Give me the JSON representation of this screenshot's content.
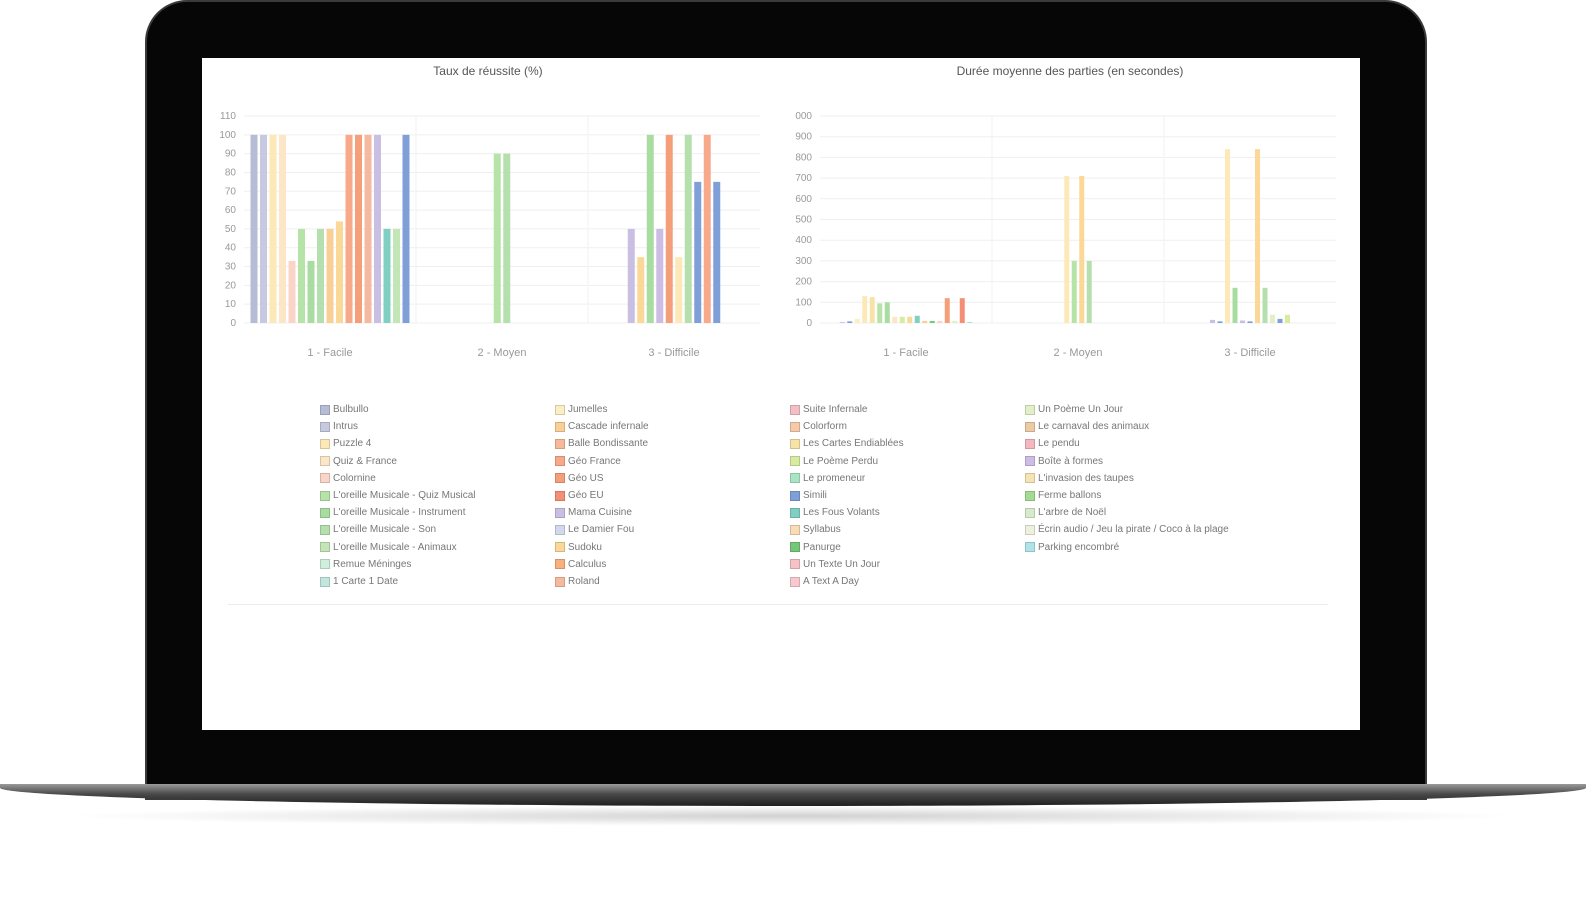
{
  "colors": {
    "Bulbullo": "#b7bcd6",
    "Intrus": "#c6c9e0",
    "Puzzle 4": "#fde9b8",
    "Quiz & France": "#fde6c8",
    "Colornine": "#f9d4c7",
    "L'oreille Musicale - Quiz Musical": "#b6e3a8",
    "L'oreille Musicale - Instrument": "#a9dca0",
    "L'oreille Musicale - Son": "#b5e0ae",
    "L'oreille Musicale - Animaux": "#c2e6b5",
    "Remue Méninges": "#cfeedd",
    "1 Carte 1 Date": "#bfe7de",
    "Jumelles": "#fbeec3",
    "Cascade infernale": "#f9cf96",
    "Balle Bondissante": "#f8b99a",
    "Géo France": "#f7a98a",
    "Géo US": "#f59e7a",
    "Géo EU": "#f28f74",
    "Mama Cuisine": "#c9bfe3",
    "Le Damier Fou": "#d3d8ee",
    "Sudoku": "#fbd897",
    "Calculus": "#f7b07e",
    "Roland": "#f5b9a0",
    "Suite Infernale": "#f3bfc4",
    "Colorform": "#f6c9aa",
    "Les Cartes Endiablées": "#f8e3a6",
    "Le Poème Perdu": "#d8eca0",
    "Le promeneur": "#a9e4c4",
    "Simili": "#7f9fd8",
    "Les Fous Volants": "#7fd0c2",
    "Syllabus": "#f8dcb4",
    "Panurge": "#74c779",
    "Un Texte Un Jour": "#f6c2c6",
    "A Text A Day": "#f7c8cf",
    "Un Poème Un Jour": "#e3efc6",
    "Le carnaval des animaux": "#eccaa3",
    "Le pendu": "#f4b7bf",
    "Boîte à formes": "#cdbde6",
    "L'invasion des taupes": "#f5e4b3",
    "Ferme ballons": "#a3db93",
    "L'arbre de Noël": "#d7ebca",
    "Écrin audio / Jeu la pirate / Coco à la plage": "#eef0de",
    "Parking encombré": "#aee3e8"
  },
  "legend_columns": [
    [
      "Bulbullo",
      "Intrus",
      "Puzzle 4",
      "Quiz & France",
      "Colornine",
      "L'oreille Musicale - Quiz Musical",
      "L'oreille Musicale - Instrument",
      "L'oreille Musicale - Son",
      "L'oreille Musicale - Animaux",
      "Remue Méninges",
      "1 Carte 1 Date"
    ],
    [
      "Jumelles",
      "Cascade infernale",
      "Balle Bondissante",
      "Géo France",
      "Géo US",
      "Géo EU",
      "Mama Cuisine",
      "Le Damier Fou",
      "Sudoku",
      "Calculus",
      "Roland"
    ],
    [
      "Suite Infernale",
      "Colorform",
      "Les Cartes Endiablées",
      "Le Poème Perdu",
      "Le promeneur",
      "Simili",
      "Les Fous Volants",
      "Syllabus",
      "Panurge",
      "Un Texte Un Jour",
      "A Text A Day"
    ],
    [
      "Un Poème Un Jour",
      "Le carnaval des animaux",
      "Le pendu",
      "Boîte à formes",
      "L'invasion des taupes",
      "Ferme ballons",
      "L'arbre de Noël",
      "Écrin audio / Jeu la pirate / Coco à la plage",
      "Parking encombré"
    ]
  ],
  "chart_data": [
    {
      "type": "bar",
      "title": "Taux de réussite (%)",
      "categories": [
        "1 - Facile",
        "2 - Moyen",
        "3 - Difficile"
      ],
      "ylim": [
        0,
        110
      ],
      "yticks": [
        0,
        10,
        20,
        30,
        40,
        50,
        60,
        70,
        80,
        90,
        100,
        110
      ],
      "grid": true,
      "groups": [
        [
          [
            "Bulbullo",
            100
          ],
          [
            "Intrus",
            100
          ],
          [
            "Puzzle 4",
            100
          ],
          [
            "Quiz & France",
            100
          ],
          [
            "Colornine",
            33
          ],
          [
            "L'oreille Musicale - Quiz Musical",
            50
          ],
          [
            "L'oreille Musicale - Instrument",
            33
          ],
          [
            "L'oreille Musicale - Son",
            50
          ],
          [
            "Cascade infernale",
            50
          ],
          [
            "Sudoku",
            54
          ],
          [
            "Géo France",
            100
          ],
          [
            "Géo US",
            100
          ],
          [
            "Roland",
            100
          ],
          [
            "Mama Cuisine",
            100
          ],
          [
            "Les Fous Volants",
            50
          ],
          [
            "L'oreille Musicale - Animaux",
            50
          ],
          [
            "Simili",
            100
          ]
        ],
        [
          [
            "L'oreille Musicale - Quiz Musical",
            90
          ],
          [
            "L'oreille Musicale - Son",
            90
          ]
        ],
        [
          [
            "Mama Cuisine",
            50
          ],
          [
            "Sudoku",
            35
          ],
          [
            "L'oreille Musicale - Instrument",
            100
          ],
          [
            "Boîte à formes",
            50
          ],
          [
            "Géo US",
            100
          ],
          [
            "Puzzle 4",
            35
          ],
          [
            "L'oreille Musicale - Son",
            100
          ],
          [
            "Simili",
            75
          ],
          [
            "Géo France",
            100
          ],
          [
            "Simili",
            75
          ]
        ]
      ]
    },
    {
      "type": "bar",
      "title": "Durée moyenne des parties (en secondes)",
      "categories": [
        "1 - Facile",
        "2 - Moyen",
        "3 - Difficile"
      ],
      "ylim": [
        0,
        1000
      ],
      "yticks": [
        0,
        100,
        200,
        300,
        400,
        500,
        600,
        700,
        800,
        900,
        1000
      ],
      "ytick_labels": [
        "0",
        "100",
        "200",
        "300",
        "400",
        "500",
        "600",
        "700",
        "800",
        "900",
        "000"
      ],
      "grid": true,
      "groups": [
        [
          [
            "Intrus",
            5
          ],
          [
            "Simili",
            8
          ],
          [
            "Jumelles",
            20
          ],
          [
            "Puzzle 4",
            130
          ],
          [
            "Les Cartes Endiablées",
            125
          ],
          [
            "L'oreille Musicale - Quiz Musical",
            95
          ],
          [
            "L'oreille Musicale - Instrument",
            100
          ],
          [
            "Quiz & France",
            30
          ],
          [
            "Le Poème Perdu",
            30
          ],
          [
            "Sudoku",
            30
          ],
          [
            "Les Fous Volants",
            35
          ],
          [
            "Cascade infernale",
            10
          ],
          [
            "Panurge",
            10
          ],
          [
            "Colornine",
            10
          ],
          [
            "Géo US",
            120
          ],
          [
            "Un Poème Un Jour",
            10
          ],
          [
            "Géo EU",
            120
          ],
          [
            "Le promeneur",
            5
          ]
        ],
        [
          [
            "Puzzle 4",
            710
          ],
          [
            "L'oreille Musicale - Quiz Musical",
            300
          ],
          [
            "Sudoku",
            710
          ],
          [
            "L'oreille Musicale - Son",
            300
          ]
        ],
        [
          [
            "Mama Cuisine",
            15
          ],
          [
            "Simili",
            8
          ],
          [
            "Puzzle 4",
            840
          ],
          [
            "L'oreille Musicale - Instrument",
            170
          ],
          [
            "Boîte à formes",
            12
          ],
          [
            "Simili",
            8
          ],
          [
            "Sudoku",
            840
          ],
          [
            "L'oreille Musicale - Son",
            170
          ],
          [
            "Un Poème Un Jour",
            40
          ],
          [
            "Simili",
            20
          ],
          [
            "Le Poème Perdu",
            40
          ]
        ]
      ]
    }
  ]
}
